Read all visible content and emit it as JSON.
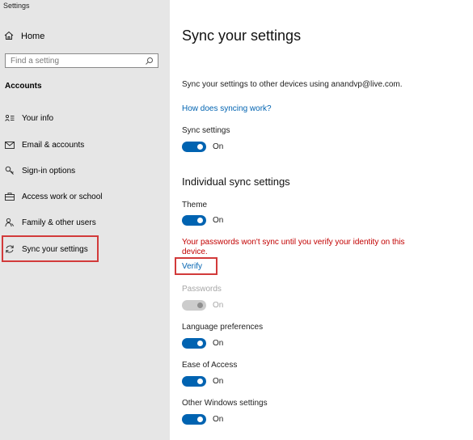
{
  "window": {
    "title": "Settings"
  },
  "sidebar": {
    "home_label": "Home",
    "search_placeholder": "Find a setting",
    "section_heading": "Accounts",
    "items": [
      {
        "label": "Your info",
        "icon": "person-card-icon"
      },
      {
        "label": "Email & accounts",
        "icon": "mail-icon"
      },
      {
        "label": "Sign-in options",
        "icon": "key-icon"
      },
      {
        "label": "Access work or school",
        "icon": "briefcase-icon"
      },
      {
        "label": "Family & other users",
        "icon": "people-icon"
      },
      {
        "label": "Sync your settings",
        "icon": "sync-icon",
        "selected": true
      }
    ]
  },
  "main": {
    "title": "Sync your settings",
    "description": "Sync your settings to other devices using anandvp@live.com.",
    "how_link": "How does syncing work?",
    "sync_settings": {
      "label": "Sync settings",
      "state": "On"
    },
    "individual_heading": "Individual sync settings",
    "theme": {
      "label": "Theme",
      "state": "On"
    },
    "warning": "Your passwords won't sync until you verify your identity on this device.",
    "verify_link": "Verify",
    "passwords": {
      "label": "Passwords",
      "state": "On",
      "disabled": true
    },
    "language": {
      "label": "Language preferences",
      "state": "On"
    },
    "ease": {
      "label": "Ease of Access",
      "state": "On"
    },
    "other": {
      "label": "Other Windows settings",
      "state": "On"
    }
  },
  "colors": {
    "sidebar_bg": "#e6e6e6",
    "accent": "#0063b1",
    "warning": "#c20000",
    "highlight_border": "#d23a3a",
    "disabled": "#a6a6a6"
  }
}
